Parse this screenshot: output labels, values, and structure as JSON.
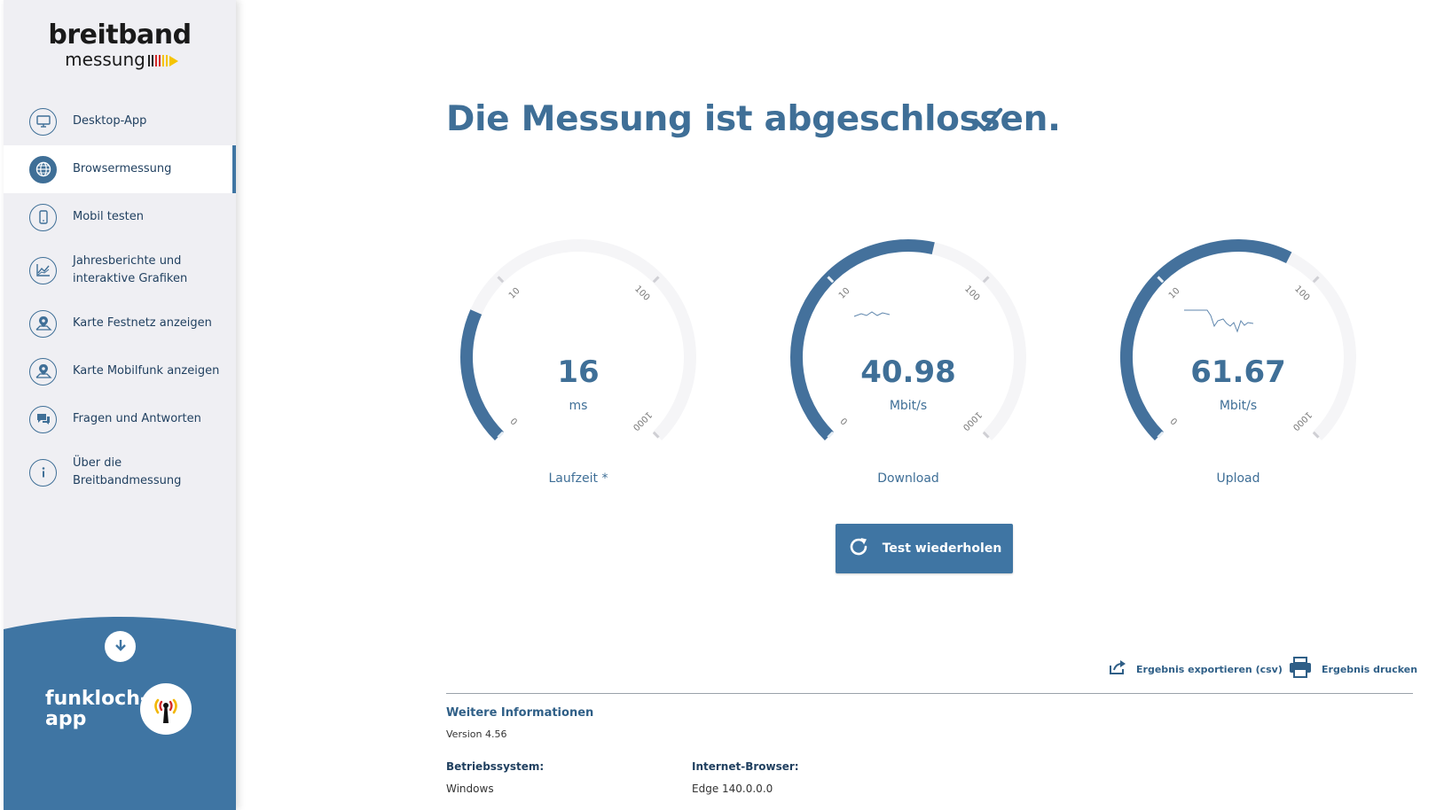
{
  "logo": {
    "top": "breitband",
    "bottom": "messung"
  },
  "sidebar": {
    "items": [
      {
        "label": "Desktop-App",
        "icon": "monitor-icon",
        "active": false
      },
      {
        "label": "Browsermessung",
        "icon": "globe-icon",
        "active": true
      },
      {
        "label": "Mobil testen",
        "icon": "mobile-icon",
        "active": false
      },
      {
        "label": "Jahresberichte und\ninteraktive Grafiken",
        "icon": "chart-icon",
        "active": false
      },
      {
        "label": "Karte Festnetz anzeigen",
        "icon": "map-pin-icon",
        "active": false
      },
      {
        "label": "Karte Mobilfunk anzeigen",
        "icon": "map-pin-icon",
        "active": false
      },
      {
        "label": "Fragen und Antworten",
        "icon": "chat-icon",
        "active": false
      },
      {
        "label": "Über die\nBreitbandmessung",
        "icon": "info-icon",
        "active": false
      }
    ],
    "promo": {
      "text": "funkloch-\napp"
    }
  },
  "main": {
    "title": "Die Messung ist abgeschlossen.",
    "gauges": [
      {
        "value": "16",
        "unit": "ms",
        "label": "Laufzeit *",
        "fill": 0.255
      },
      {
        "value": "40.98",
        "unit": "Mbit/s",
        "label": "Download",
        "fill": 0.548
      },
      {
        "value": "61.67",
        "unit": "Mbit/s",
        "label": "Upload",
        "fill": 0.6
      }
    ],
    "ticks": {
      "t0": "0",
      "t10": "10",
      "t100": "100",
      "t1000": "1000"
    },
    "retry_label": "Test wiederholen",
    "export_label": "Ergebnis exportieren (csv)",
    "print_label": "Ergebnis drucken",
    "info": {
      "title": "Weitere Informationen",
      "version": "Version 4.56",
      "os_label": "Betriebssystem:",
      "os_value": "Windows",
      "browser_label": "Internet-Browser:",
      "browser_value": "Edge 140.0.0.0"
    }
  },
  "colors": {
    "accent": "#3f6f97",
    "button": "#3f75a3",
    "sidebar_bg": "#efeff3",
    "promo_bg": "#3f75a3"
  }
}
